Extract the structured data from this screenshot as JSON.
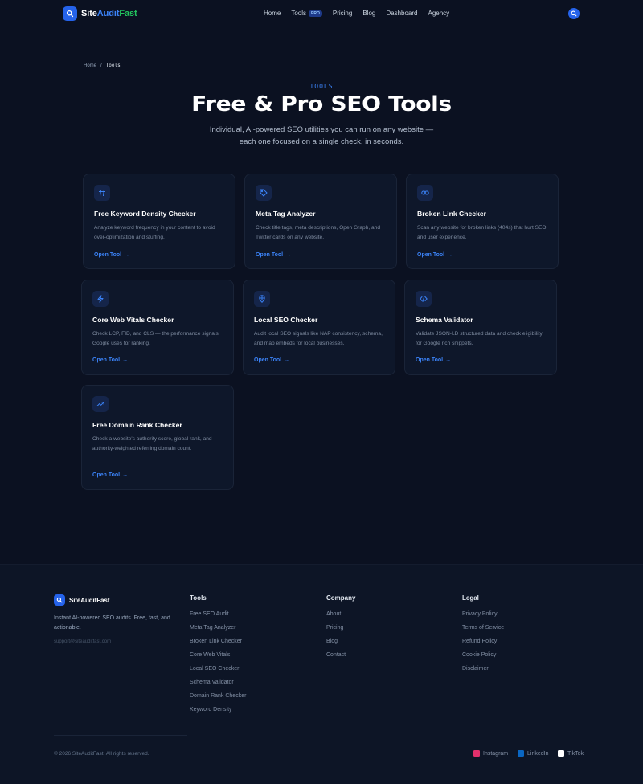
{
  "nav": {
    "brand": {
      "part1": "Site",
      "part2": "Audit",
      "part3": "Fast"
    },
    "links": [
      {
        "label": "Home"
      },
      {
        "label": "Tools",
        "badge": "PRO"
      },
      {
        "label": "Pricing"
      },
      {
        "label": "Blog"
      },
      {
        "label": "Dashboard"
      },
      {
        "label": "Agency"
      }
    ],
    "search_icon": "search-icon"
  },
  "breadcrumb": {
    "home": "Home",
    "separator": "/",
    "current": "Tools"
  },
  "hero": {
    "eyebrow": "TOOLS",
    "title": "Free & Pro SEO Tools",
    "subtitle_line1": "Individual, AI-powered SEO utilities you can run on any website —",
    "subtitle_line2": "each one focused on a single check, in seconds."
  },
  "cards": [
    {
      "icon": "hash-icon",
      "title": "Free Keyword Density Checker",
      "desc": "Analyze keyword frequency in your content to avoid over-optimization and stuffing.",
      "link": "Open Tool"
    },
    {
      "icon": "tag-icon",
      "title": "Meta Tag Analyzer",
      "desc": "Check title tags, meta descriptions, Open Graph, and Twitter cards on any website.",
      "link": "Open Tool"
    },
    {
      "icon": "link-icon",
      "title": "Broken Link Checker",
      "desc": "Scan any website for broken links (404s) that hurt SEO and user experience.",
      "link": "Open Tool"
    },
    {
      "icon": "lightning-icon",
      "title": "Core Web Vitals Checker",
      "desc": "Check LCP, FID, and CLS — the performance signals Google uses for ranking.",
      "link": "Open Tool"
    },
    {
      "icon": "map-pin-icon",
      "title": "Local SEO Checker",
      "desc": "Audit local SEO signals like NAP consistency, schema, and map embeds for local businesses.",
      "link": "Open Tool"
    },
    {
      "icon": "code-icon",
      "title": "Schema Validator",
      "desc": "Validate JSON-LD structured data and check eligibility for Google rich snippets.",
      "link": "Open Tool"
    },
    {
      "icon": "trending-up-icon",
      "title": "Free Domain Rank Checker",
      "desc": "Check a website's authority score, global rank, and authority-weighted referring domain count.",
      "link": "Open Tool"
    }
  ],
  "footer": {
    "brand": "SiteAuditFast",
    "tagline": "Instant AI-powered SEO audits. Free, fast, and actionable.",
    "email": "support@siteauditfast.com",
    "columns": [
      {
        "title": "Tools",
        "items": [
          "Free SEO Audit",
          "Meta Tag Analyzer",
          "Broken Link Checker",
          "Core Web Vitals",
          "Local SEO Checker",
          "Schema Validator",
          "Domain Rank Checker",
          "Keyword Density"
        ]
      },
      {
        "title": "Company",
        "items": [
          "About",
          "Pricing",
          "Blog",
          "Contact"
        ]
      },
      {
        "title": "Legal",
        "items": [
          "Privacy Policy",
          "Terms of Service",
          "Refund Policy",
          "Cookie Policy",
          "Disclaimer"
        ]
      }
    ],
    "copyright": "© 2026 SiteAuditFast. All rights reserved.",
    "social": [
      {
        "label": "Instagram",
        "icon": "instagram-icon",
        "color": "#e1306c"
      },
      {
        "label": "LinkedIn",
        "icon": "linkedin-icon",
        "color": "#0a66c2"
      },
      {
        "label": "TikTok",
        "icon": "tiktok-icon",
        "color": "#ffffff"
      }
    ]
  },
  "colors": {
    "accent": "#2563eb",
    "link": "#3b82f6",
    "background": "#0b1121",
    "card": "#0e172a"
  }
}
